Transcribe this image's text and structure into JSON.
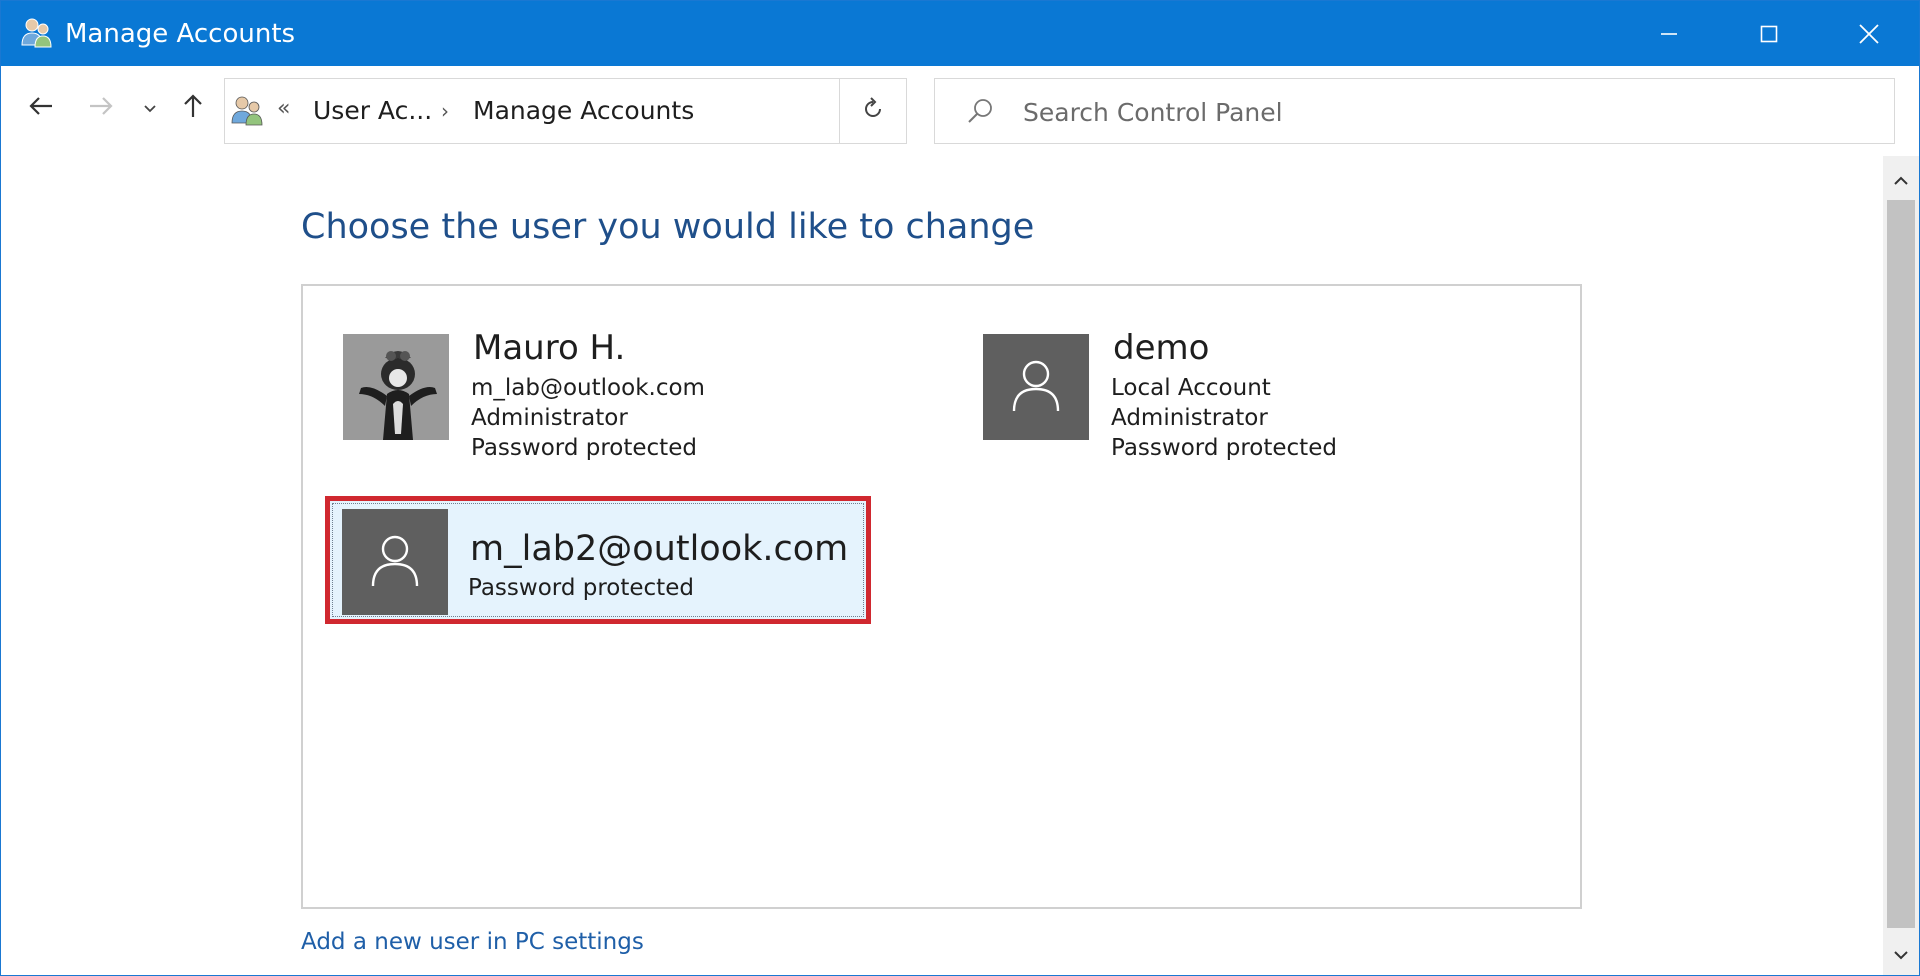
{
  "window": {
    "title": "Manage Accounts",
    "title_icon": "user-accounts-icon",
    "controls": {
      "minimize": "minimize-icon",
      "maximize": "maximize-icon",
      "close": "close-icon"
    },
    "accent_color": "#0a78d4"
  },
  "navigation": {
    "back": "back-arrow-icon",
    "forward": "forward-arrow-icon",
    "recent": "chevron-down-icon",
    "up": "up-arrow-icon"
  },
  "address_bar": {
    "icon": "user-accounts-icon",
    "overflow": "«",
    "breadcrumbs": [
      "User Ac...",
      "Manage Accounts"
    ],
    "separator": "›",
    "dropdown": "chevron-down-icon",
    "refresh": "refresh-icon"
  },
  "search": {
    "placeholder": "Search Control Panel",
    "value": ""
  },
  "main": {
    "heading": "Choose the user you would like to change",
    "accounts": [
      {
        "name": "Mauro H.",
        "details": [
          "m_lab@outlook.com",
          "Administrator",
          "Password protected"
        ],
        "avatar": "photo-avatar",
        "selected": false
      },
      {
        "name": "demo",
        "details": [
          "Local Account",
          "Administrator",
          "Password protected"
        ],
        "avatar": "user-icon",
        "selected": false
      },
      {
        "name": "m_lab2@outlook.com",
        "details": [
          "Password protected"
        ],
        "avatar": "user-icon",
        "selected": true
      }
    ],
    "add_user_link": "Add a new user in PC settings"
  },
  "colors": {
    "heading": "#1f4f8a",
    "link": "#1f5fa8",
    "highlight_border": "#d0282f",
    "selected_bg": "#e5f3fd",
    "avatar_bg": "#5f5f5f"
  }
}
